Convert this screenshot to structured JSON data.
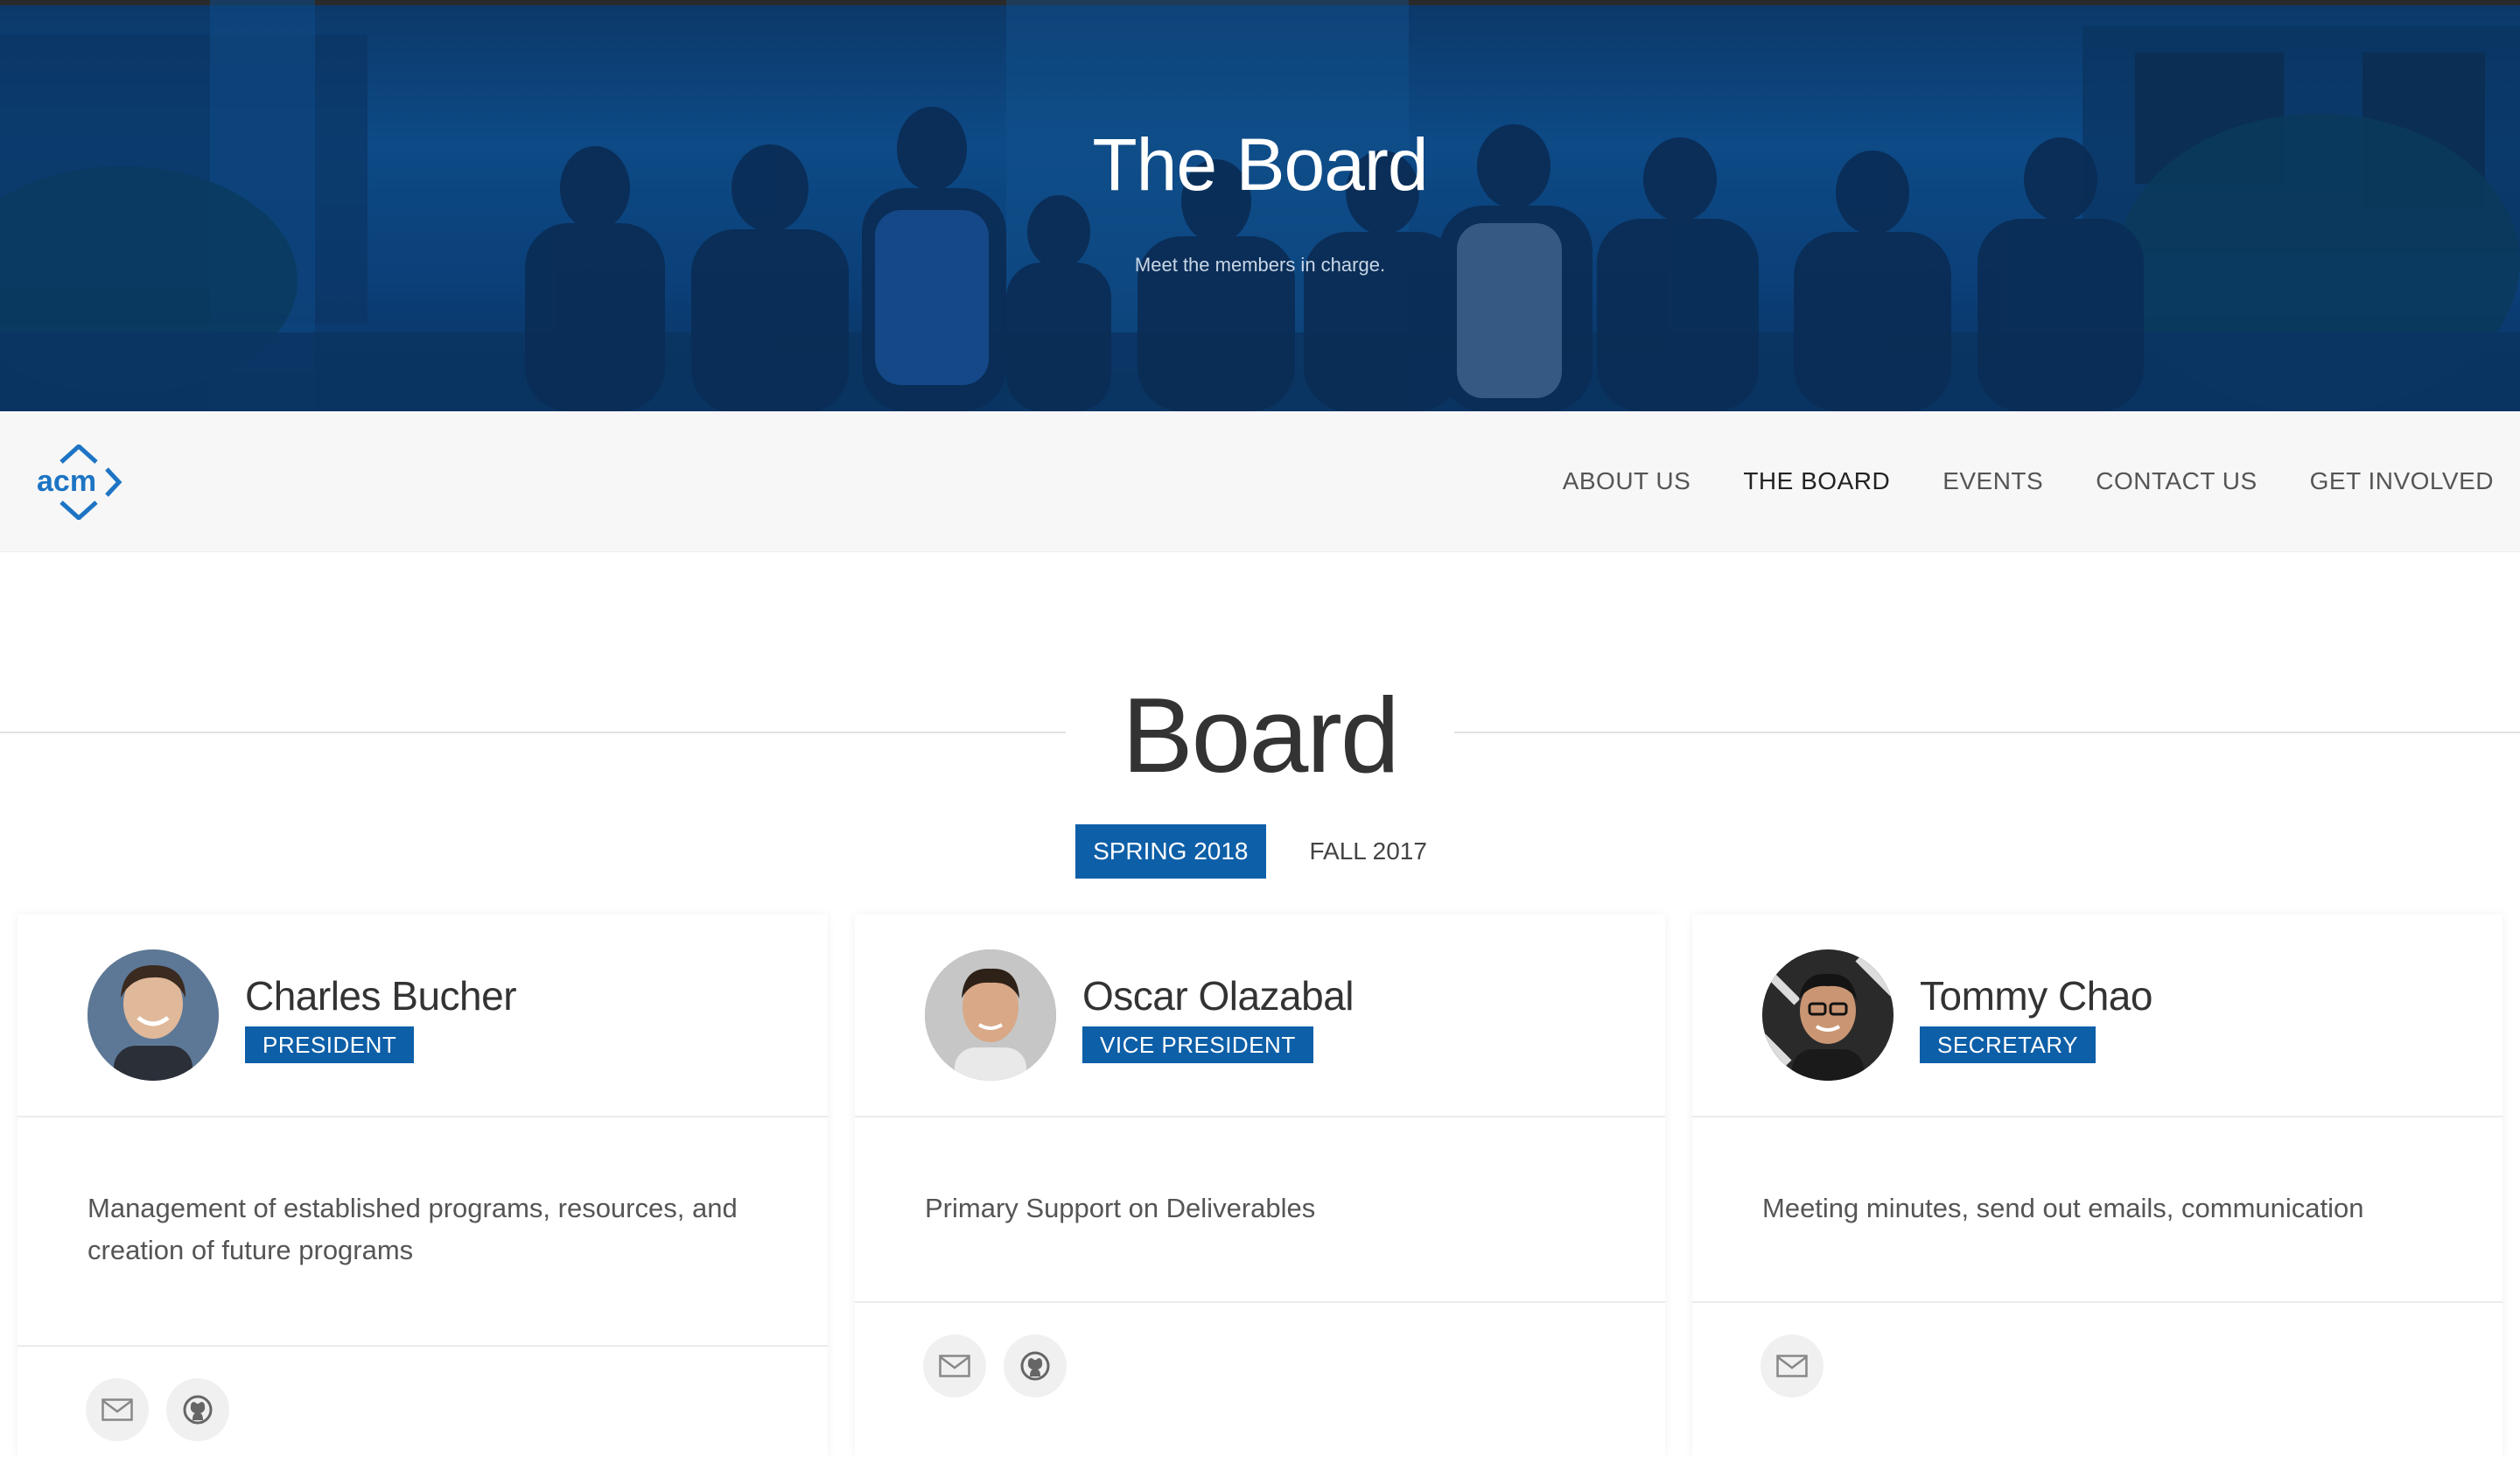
{
  "hero": {
    "title": "The Board",
    "subtitle": "Meet the members in charge."
  },
  "nav": {
    "logo_text": "acm",
    "links": [
      {
        "label": "ABOUT US"
      },
      {
        "label": "THE BOARD"
      },
      {
        "label": "EVENTS"
      },
      {
        "label": "CONTACT US"
      },
      {
        "label": "GET INVOLVED"
      }
    ],
    "active": "THE BOARD"
  },
  "section": {
    "heading": "Board"
  },
  "tabs": [
    {
      "label": "SPRING 2018",
      "active": true
    },
    {
      "label": "FALL 2017",
      "active": false
    }
  ],
  "members": [
    {
      "name": "Charles Bucher",
      "role": "PRESIDENT",
      "description": "Management of established programs, resources, and creation of future programs",
      "links": [
        "mail-icon",
        "github-icon"
      ]
    },
    {
      "name": "Oscar Olazabal",
      "role": "VICE PRESIDENT",
      "description": "Primary Support on Deliverables",
      "links": [
        "mail-icon",
        "github-icon"
      ]
    },
    {
      "name": "Tommy Chao",
      "role": "SECRETARY",
      "description": "Meeting minutes, send out emails, communication",
      "links": [
        "mail-icon"
      ]
    }
  ],
  "colors": {
    "accent": "#0d5fa8",
    "hero_overlay": "#0c3f78",
    "navbar_bg": "#f7f7f7"
  }
}
